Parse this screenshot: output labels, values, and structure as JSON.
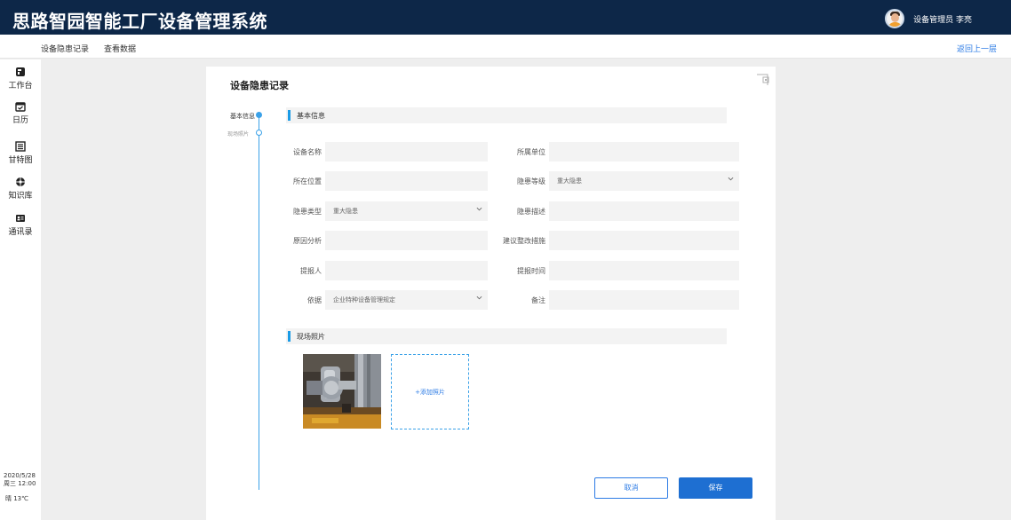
{
  "app": {
    "title": "思路智园智能工厂设备管理系统"
  },
  "user": {
    "name": "设备管理员  李亮"
  },
  "subnav": {
    "items": [
      "设备隐患记录",
      "查看数据"
    ],
    "back": "返回上一层"
  },
  "sidebar": {
    "items": [
      {
        "label": "工作台",
        "icon": "workbench-icon"
      },
      {
        "label": "日历",
        "icon": "calendar-icon"
      },
      {
        "label": "甘特图",
        "icon": "gantt-icon"
      },
      {
        "label": "知识库",
        "icon": "knowledge-icon"
      },
      {
        "label": "通讯录",
        "icon": "contacts-icon"
      }
    ],
    "date": "2020/5/28",
    "time": "周三  12:00",
    "weather": "晴  13℃"
  },
  "page": {
    "title": "设备隐患记录",
    "timeline": [
      "基本信息",
      "现场照片"
    ],
    "sections": {
      "basic": "基本信息",
      "photos": "现场照片"
    },
    "fields": {
      "device_name": {
        "label": "设备名称",
        "value": ""
      },
      "unit": {
        "label": "所属单位",
        "value": ""
      },
      "location": {
        "label": "所在位置",
        "value": ""
      },
      "level": {
        "label": "隐患等级",
        "value": "重大隐患"
      },
      "type": {
        "label": "隐患类型",
        "value": "重大隐患"
      },
      "desc": {
        "label": "隐患描述",
        "value": ""
      },
      "cause": {
        "label": "原因分析",
        "value": ""
      },
      "suggestion": {
        "label": "建议整改措施",
        "value": ""
      },
      "reporter": {
        "label": "提报人",
        "value": ""
      },
      "report_time": {
        "label": "提报时间",
        "value": ""
      },
      "basis": {
        "label": "依据",
        "value": "企业特种设备管理规定"
      },
      "remark": {
        "label": "备注",
        "value": ""
      }
    },
    "add_photo": "+添加照片",
    "cancel": "取消",
    "save": "保存"
  },
  "colors": {
    "topbar": "#0d2748",
    "accent": "#1a9be6",
    "primary": "#1e6fd2"
  }
}
